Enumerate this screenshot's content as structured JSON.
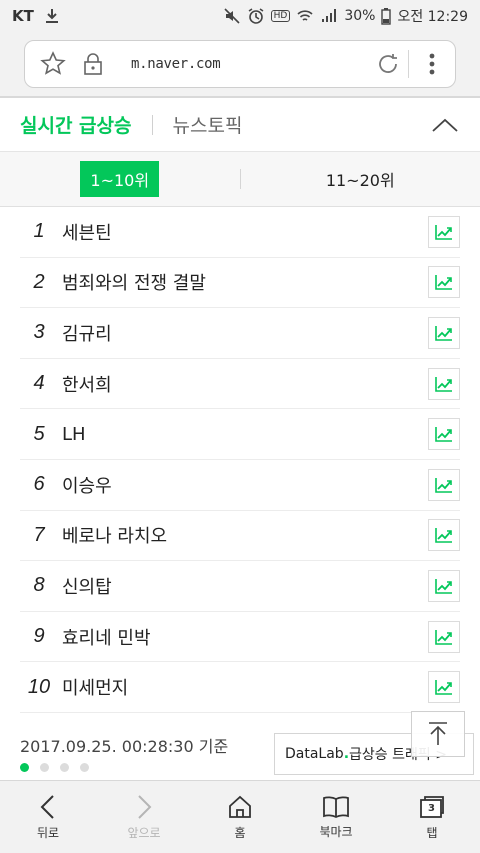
{
  "status_bar": {
    "carrier": "KT",
    "battery": "30%",
    "time": "오전 12:29",
    "hd_label": "HD"
  },
  "browser": {
    "url": "m.naver.com"
  },
  "topics": {
    "active_tab": "실시간 급상승",
    "other_tab": "뉴스토픽"
  },
  "range_tabs": {
    "active": "1~10위",
    "other": "11~20위"
  },
  "ranks": [
    {
      "num": "1",
      "keyword": "세븐틴"
    },
    {
      "num": "2",
      "keyword": "범죄와의 전쟁 결말"
    },
    {
      "num": "3",
      "keyword": "김규리"
    },
    {
      "num": "4",
      "keyword": "한서희"
    },
    {
      "num": "5",
      "keyword": "LH"
    },
    {
      "num": "6",
      "keyword": "이승우"
    },
    {
      "num": "7",
      "keyword": "베로나 라치오"
    },
    {
      "num": "8",
      "keyword": "신의탑"
    },
    {
      "num": "9",
      "keyword": "효리네 민박"
    },
    {
      "num": "10",
      "keyword": "미세먼지"
    }
  ],
  "footer": {
    "timestamp": "2017.09.25. 00:28:30 기준",
    "datalab_brand_a": "DataLab",
    "datalab_brand_dot": ".",
    "datalab_text": "급상승 트래픽 >",
    "page_count": 4,
    "active_page": 1
  },
  "bottom_nav": {
    "back": "뒤로",
    "forward": "앞으로",
    "home": "홈",
    "bookmarks": "북마크",
    "tabs": "탭",
    "tab_count": "3"
  },
  "colors": {
    "accent": "#03c75a"
  }
}
